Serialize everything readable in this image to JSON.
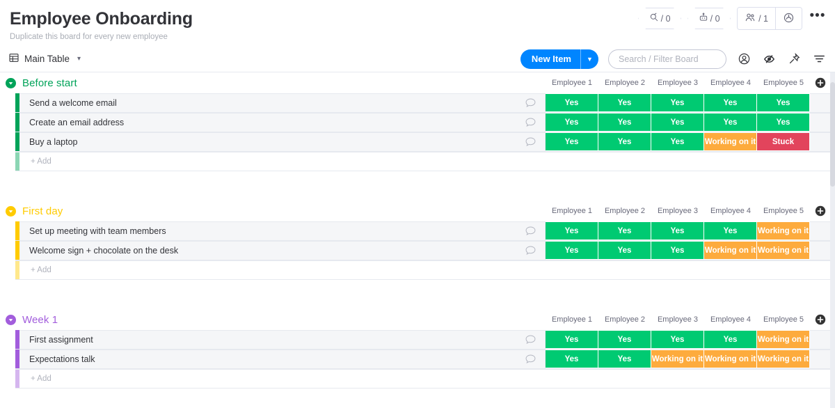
{
  "header": {
    "title": "Employee Onboarding",
    "subtitle": "Duplicate this board for every new employee",
    "chips": [
      {
        "icon": "activity-log-icon",
        "value": "/ 0"
      },
      {
        "icon": "automations-robot-icon",
        "value": "/ 0"
      }
    ],
    "members": {
      "icon": "people-icon",
      "value": "/ 1"
    },
    "integrations_icon": "integrations-icon",
    "more_icon": "more-options-icon"
  },
  "toolbar": {
    "view_icon": "table-icon",
    "view_label": "Main Table",
    "view_caret": "chevron-down-icon",
    "new_item_label": "New Item",
    "new_item_caret": "chevron-down-icon",
    "search_placeholder": "Search / Filter Board",
    "search_value": "",
    "icons": [
      {
        "name": "person-filter-icon"
      },
      {
        "name": "hide-eye-icon"
      },
      {
        "name": "pin-icon"
      },
      {
        "name": "filter-icon"
      }
    ]
  },
  "board": {
    "columns": [
      "Employee 1",
      "Employee 2",
      "Employee 3",
      "Employee 4",
      "Employee 5"
    ],
    "add_column_icon": "plus-circle-icon",
    "add_row_label": "+ Add",
    "collapse_icon": "collapse-group-icon",
    "comment_icon": "comment-bubble-icon",
    "status_colors": {
      "Yes": "#00ca72",
      "Working on it": "#fdab3d",
      "Stuck": "#e2445c"
    },
    "groups": [
      {
        "name": "Before start",
        "color": "#00a359",
        "items": [
          {
            "name": "Send a welcome email",
            "statuses": [
              "Yes",
              "Yes",
              "Yes",
              "Yes",
              "Yes"
            ]
          },
          {
            "name": "Create an email address",
            "statuses": [
              "Yes",
              "Yes",
              "Yes",
              "Yes",
              "Yes"
            ]
          },
          {
            "name": "Buy a laptop",
            "statuses": [
              "Yes",
              "Yes",
              "Yes",
              "Working on it",
              "Stuck"
            ]
          }
        ]
      },
      {
        "name": "First day",
        "color": "#ffcb00",
        "items": [
          {
            "name": "Set up meeting with team members",
            "statuses": [
              "Yes",
              "Yes",
              "Yes",
              "Yes",
              "Working on it"
            ]
          },
          {
            "name": "Welcome sign + chocolate on the desk",
            "statuses": [
              "Yes",
              "Yes",
              "Yes",
              "Working on it",
              "Working on it"
            ]
          }
        ]
      },
      {
        "name": "Week 1",
        "color": "#a25ddc",
        "items": [
          {
            "name": "First assignment",
            "statuses": [
              "Yes",
              "Yes",
              "Yes",
              "Yes",
              "Working on it"
            ]
          },
          {
            "name": "Expectations talk",
            "statuses": [
              "Yes",
              "Yes",
              "Working on it",
              "Working on it",
              "Working on it"
            ]
          }
        ]
      }
    ]
  }
}
